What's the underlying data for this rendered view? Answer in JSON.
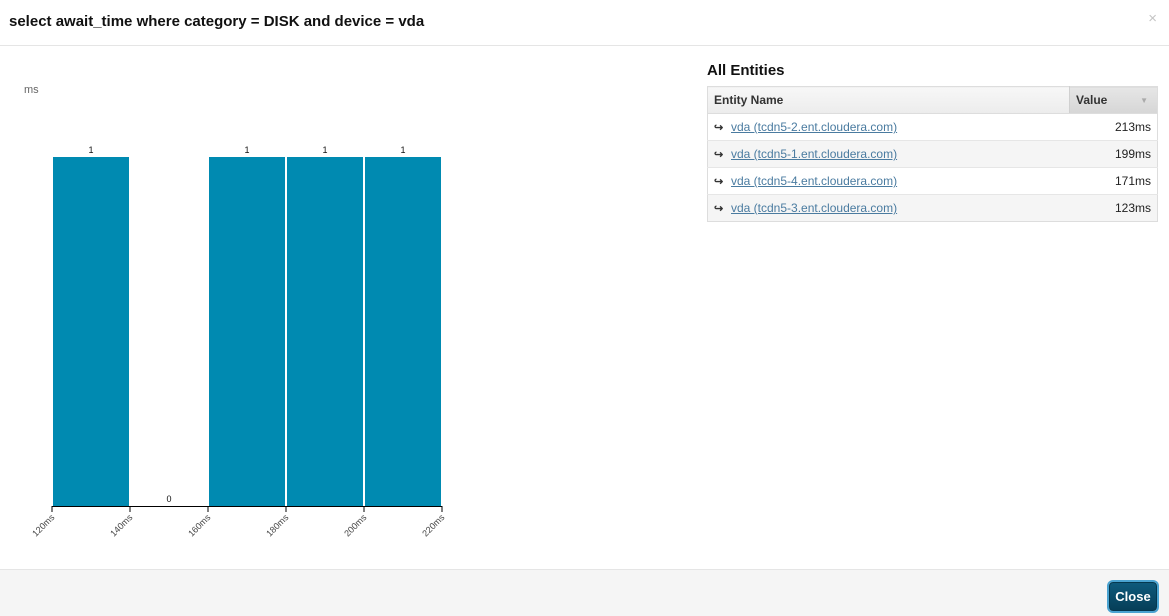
{
  "modal": {
    "title": "select await_time where category = DISK and device = vda",
    "close_x": "×",
    "close_button": "Close"
  },
  "chart_data": {
    "type": "bar",
    "ylabel": "ms",
    "xlabel": "",
    "bins": [
      {
        "from": 120,
        "to": 140,
        "count": 1
      },
      {
        "from": 140,
        "to": 160,
        "count": 0
      },
      {
        "from": 160,
        "to": 180,
        "count": 1
      },
      {
        "from": 180,
        "to": 200,
        "count": 1
      },
      {
        "from": 200,
        "to": 220,
        "count": 1
      }
    ],
    "x_ticks": [
      "120ms",
      "140ms",
      "160ms",
      "180ms",
      "200ms",
      "220ms"
    ],
    "xlim": [
      120,
      220
    ],
    "ylim": [
      0,
      1
    ],
    "bar_color": "#008ab1"
  },
  "entities": {
    "title": "All Entities",
    "columns": {
      "name": "Entity Name",
      "value": "Value"
    },
    "rows": [
      {
        "name": "vda (tcdn5-2.ent.cloudera.com)",
        "value": "213ms"
      },
      {
        "name": "vda (tcdn5-1.ent.cloudera.com)",
        "value": "199ms"
      },
      {
        "name": "vda (tcdn5-4.ent.cloudera.com)",
        "value": "171ms"
      },
      {
        "name": "vda (tcdn5-3.ent.cloudera.com)",
        "value": "123ms"
      }
    ]
  }
}
